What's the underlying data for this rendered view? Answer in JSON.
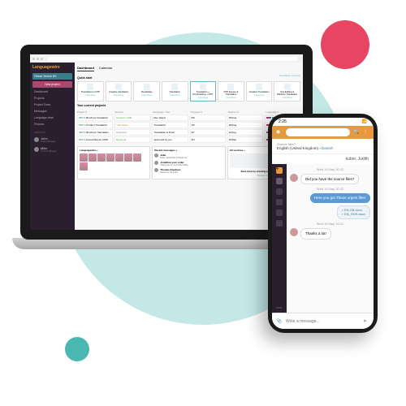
{
  "status_time": "2:26",
  "brand": "Languagewire",
  "sidebar": {
    "selector": "Global Search B2",
    "cta": "New project",
    "items": [
      "Dashboard",
      "Projects",
      "Project Team",
      "Messages",
      "Language desk",
      "Finance"
    ],
    "section": "SUPPORT",
    "users": [
      {
        "name": "John",
        "role": "Project Manager"
      },
      {
        "name": "Mike",
        "role": "Account Manager"
      }
    ]
  },
  "tabs": [
    "Dashboard",
    "Calendar"
  ],
  "quick": {
    "title": "Quick start",
    "link": "Translation services",
    "cards": [
      {
        "t": "Translation to DTP",
        "s": "5 last times"
      },
      {
        "t": "Creative translation",
        "s": "3 last times"
      },
      {
        "t": "Revalidate",
        "s": "2 last times"
      },
      {
        "t": "Translation",
        "s": "5 last times"
      },
      {
        "t": "Translation + Proofreading + DTP",
        "s": "3 last times"
      },
      {
        "t": "DTP license & Translation",
        "s": "3 last times"
      },
      {
        "t": "Creative Translation",
        "s": "2 last times"
      },
      {
        "t": "Text Editing & Machine Translation",
        "s": "2 last times"
      }
    ]
  },
  "projects": {
    "title": "Your current projects",
    "cols": [
      "Project ▾",
      "Service",
      "Language / Sort",
      "Progress ▾",
      "Delivery ▾",
      "Language ▾"
    ],
    "rows": [
      {
        "id": "98073",
        "name": "Brochure translation",
        "svc": "Content / draft",
        "st": "Due (days)",
        "pr": "0/6",
        "dl": "25/Aug"
      },
      {
        "id": "98072",
        "name": "Product Translation",
        "svc": "Translation",
        "st": "Translation",
        "pr": "1/6",
        "dl": "26/Aug"
      },
      {
        "id": "98070",
        "name": "Brochure Translation",
        "svc": "Released",
        "st": "Translation & Proof",
        "pr": "3/7",
        "dl": "11/Aug"
      },
      {
        "id": "98073",
        "name": "Annual Report 2018",
        "svc": "Revenue",
        "st": "Approved by you",
        "pr": "3/3",
        "dl": "10/Sep"
      }
    ]
  },
  "panels": {
    "team": "Languagewire +",
    "msgs_h": "Recent messages +",
    "msgs": [
      {
        "n": "Julie",
        "t": "Hello I would like to thank you"
      },
      {
        "n": "Jonathan your order",
        "t": "Thank you for your order today"
      },
      {
        "n": "Thomas Knudsen",
        "t": "Please let me know"
      }
    ],
    "disc": "All services +",
    "disc_t": "Save time by creating project templates",
    "disc_b": "Discover more"
  },
  "mobile": {
    "sub_label": "Source files?",
    "sub_value": "English (United Kingdom) > Danish",
    "name": "kuber, Judith",
    "dates": [
      "Wed 11 May 10:22",
      "Wed 11 May 10:32",
      "Wed 12 May 10:12"
    ],
    "m1": "Did you have the source files?",
    "m2": "Here you go! These urgent files:",
    "attach": [
      "> EN.GB.docx",
      "> EN_GDS.docx"
    ],
    "m3": "Thanks a lot!",
    "placeholder": "Write a message..."
  }
}
